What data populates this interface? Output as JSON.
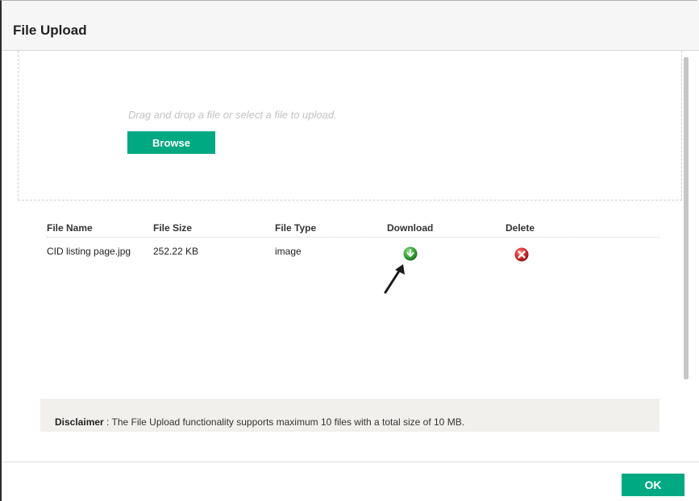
{
  "dialog": {
    "title": "File Upload"
  },
  "dropzone": {
    "hint": "Drag and drop a file or select a file to upload.",
    "browse_label": "Browse"
  },
  "table": {
    "columns": [
      "File Name",
      "File Size",
      "File Type",
      "Download",
      "Delete"
    ],
    "rows": [
      {
        "file_name": "CID listing page.jpg",
        "file_size": "252.22 KB",
        "file_type": "image",
        "download_icon": "download-icon",
        "delete_icon": "delete-icon"
      }
    ]
  },
  "disclaimer": {
    "label": "Disclaimer",
    "separator": " : ",
    "text": "The File Upload functionality supports maximum 10 files with a total size of 10 MB."
  },
  "footer": {
    "ok_label": "OK"
  },
  "colors": {
    "accent": "#01a982",
    "download_icon": "#3aa83a",
    "delete_icon": "#d62b2b"
  }
}
